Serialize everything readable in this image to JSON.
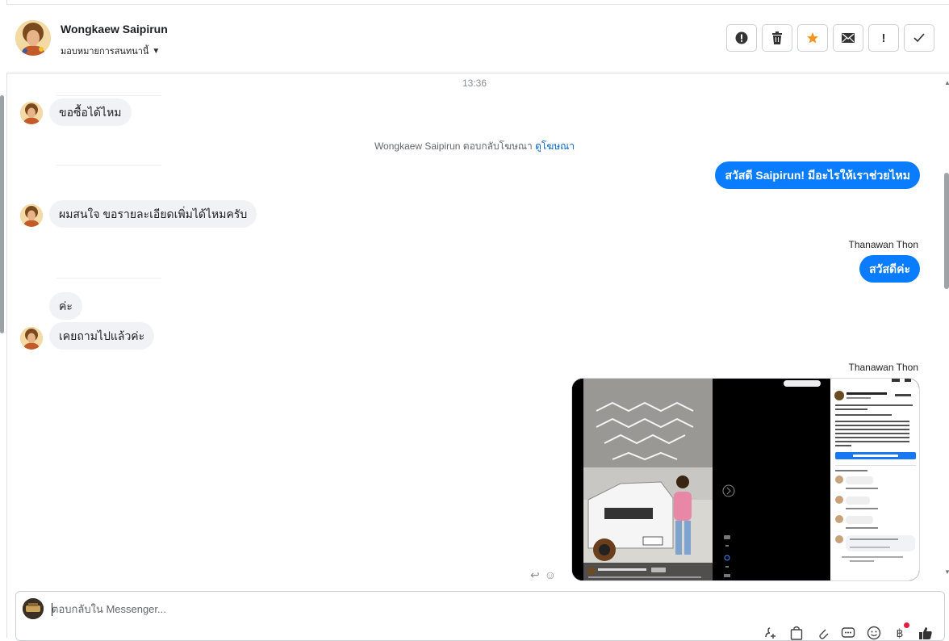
{
  "header": {
    "contact_name": "Wongkaew Saipirun",
    "assign_label": "มอบหมายการสนทนานี้",
    "actions": [
      {
        "name": "report-button",
        "icon": "exclamation-circle-icon"
      },
      {
        "name": "delete-button",
        "icon": "trash-icon"
      },
      {
        "name": "star-button",
        "icon": "star-icon"
      },
      {
        "name": "mark-unread-button",
        "icon": "envelope-icon"
      },
      {
        "name": "follow-up-button",
        "icon": "exclamation-icon"
      },
      {
        "name": "mark-done-button",
        "icon": "check-icon"
      }
    ]
  },
  "conversation": {
    "timestamp": "13:36",
    "messages": {
      "m1": "ขอซื้อได้ไหม",
      "notice_text": "Wongkaew Saipirun ตอบกลับโฆษณา",
      "notice_link": "ดูโฆษณา",
      "m2": "สวัสดี Saipirun! มีอะไรให้เราช่วยไหม",
      "m3": "ผมสนใจ ขอรายละเอียดเพิ่มได้ไหมครับ",
      "sender_1": "Thanawan Thon",
      "m4": "สวัสดีค่ะ",
      "m5": "ค่ะ",
      "m6": "เคยถามไปแล้วค่ะ",
      "sender_2": "Thanawan Thon"
    },
    "screenshot": {
      "page_name": "รถมือสองอีซูซุ โรงหลวงโหย",
      "post_text": "ขายรถกระบะ ISUZU D-MAX ALL NEW Cab-4 1.9 Ddi S 2020",
      "cta": "ไปที่โฆษณาเพื่อ Posts",
      "caption": "รถมือสองอีซูซุ โรงหลวงโหย มูลฯ กิ ติดตาม"
    }
  },
  "composer": {
    "placeholder": "ตอบกลับใน Messenger...",
    "tools": [
      "add-contact-icon",
      "bag-icon",
      "paperclip-icon",
      "saved-reply-icon",
      "emoji-icon",
      "payment-icon",
      "thumbs-up-icon"
    ]
  },
  "colors": {
    "accent": "#0a7cff",
    "star": "#f7931e",
    "incoming_bubble": "#f0f2f5"
  }
}
